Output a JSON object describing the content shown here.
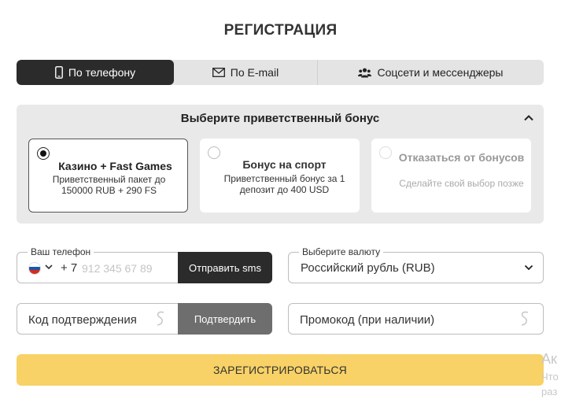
{
  "title": "РЕГИСТРАЦИЯ",
  "tabs": [
    {
      "label": "По телефону",
      "icon": "phone-icon",
      "active": true
    },
    {
      "label": "По E-mail",
      "icon": "envelope-icon",
      "active": false
    },
    {
      "label": "Соцсети и мессенджеры",
      "icon": "users-icon",
      "active": false
    }
  ],
  "bonus": {
    "heading": "Выберите приветственный бонус",
    "options": [
      {
        "title": "Казино + Fast Games",
        "description": "Приветственный пакет до 150000 RUB + 290 FS",
        "selected": true
      },
      {
        "title": "Бонус на спорт",
        "description": "Приветственный бонус за 1 депозит до 400 USD",
        "selected": false
      },
      {
        "title": "Отказаться от бонусов",
        "description": "Сделайте свой выбор позже",
        "selected": false
      }
    ]
  },
  "phone": {
    "label": "Ваш телефон",
    "prefix": "+ 7",
    "placeholder": "912 345 67 89",
    "send_sms": "Отправить sms",
    "country_flag_colors": [
      "#ffffff",
      "#1c57a5",
      "#d52b1e"
    ]
  },
  "currency": {
    "label": "Выберите валюту",
    "value": "Российский рубль (RUB)"
  },
  "code": {
    "placeholder": "Код подтверждения",
    "confirm": "Подтвердить"
  },
  "promo": {
    "placeholder": "Промокод (при наличии)"
  },
  "register_label": "ЗАРЕГИСТРИРОВАТЬСЯ",
  "watermark": [
    "Ак",
    "Что",
    "раз"
  ],
  "colors": {
    "accent_yellow": "#f8d266",
    "dark": "#2b2b2b",
    "panel_grey": "#e9e9e9"
  }
}
